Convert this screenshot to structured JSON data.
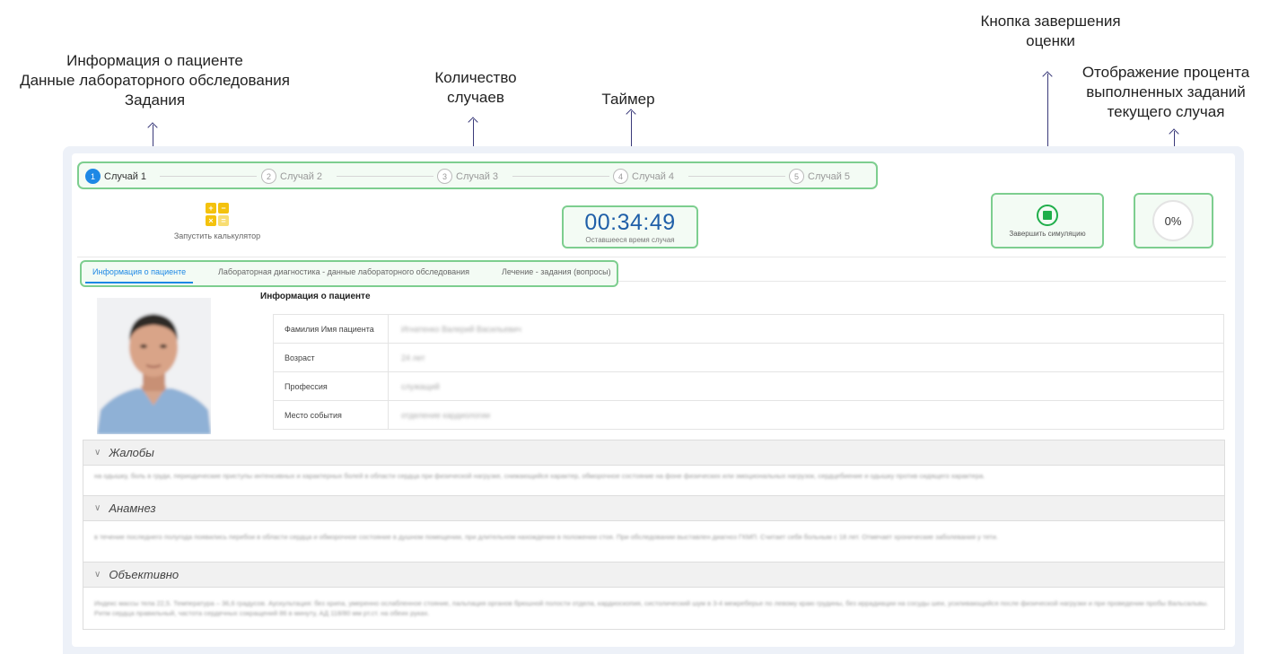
{
  "annotations": {
    "tabs_note": [
      "Информация о пациенте",
      "Данные лабораторного обследования",
      "Задания"
    ],
    "cases_note": [
      "Количество",
      "случаев"
    ],
    "timer_note": "Таймер",
    "finish_note": [
      "Кнопка завершения",
      "оценки"
    ],
    "percent_note": [
      "Отображение процента",
      "выполненных заданий",
      "текущего случая"
    ]
  },
  "cases": [
    {
      "num": "1",
      "label": "Случай 1"
    },
    {
      "num": "2",
      "label": "Случай 2"
    },
    {
      "num": "3",
      "label": "Случай 3"
    },
    {
      "num": "4",
      "label": "Случай 4"
    },
    {
      "num": "5",
      "label": "Случай 5"
    }
  ],
  "calculator": {
    "label": "Запустить калькулятор",
    "icon": "calculator-icon"
  },
  "timer": {
    "value": "00:34:49",
    "label": "Оставшееся время случая"
  },
  "finish": {
    "label": "Завершить симуляцию",
    "icon": "stop-icon"
  },
  "progress": {
    "value": "0%"
  },
  "tabs": [
    {
      "label": "Информация о пациенте"
    },
    {
      "label": "Лабораторная диагностика - данные лабораторного обследования"
    },
    {
      "label": "Лечение - задания (вопросы)"
    }
  ],
  "patient": {
    "section_title": "Информация о пациенте",
    "rows": [
      {
        "key": "Фамилия Имя пациента",
        "value": "Игнатенко Валерий Васильевич"
      },
      {
        "key": "Возраст",
        "value": "24 лет"
      },
      {
        "key": "Профессия",
        "value": "служащий"
      },
      {
        "key": "Место события",
        "value": "отделение кардиологии"
      }
    ]
  },
  "sections": [
    {
      "title": "Жалобы",
      "body": "на одышку, боль в груди, периодические приступы интенсивных и характерных болей в области сердца при физической нагрузке, снижающийся характер, обморочное состояние на фоне физических или эмоциональных нагрузок, сердцебиение и одышку против сидящего характера."
    },
    {
      "title": "Анамнез",
      "body": "в течение последнего полугода появились перебои в области сердца и обморочное состояние в душном помещении, при длительном нахождении в положении стоя. При обследовании выставлен диагноз ГКМП. Считает себя больным с 18 лет. Отмечает хронические заболевания у тети."
    },
    {
      "title": "Объективно",
      "body": "Индекс массы тела 22,5. Температура – 36,6 градусов. Аускультация: без хрипа, умеренно ослабленное стояние, пальпация органов брюшной полости отдела, кардиоскопия, систолический шум в 3-4 межреберье по левому краю грудины, без иррадиации на сосуды шеи, усиливающийся после физической нагрузки и при проведении пробы Вальсальвы. Ритм сердца правильный, частота сердечных сокращений 86 в минуту, АД 118/80 мм рт.ст. на обеих руках."
    }
  ]
}
